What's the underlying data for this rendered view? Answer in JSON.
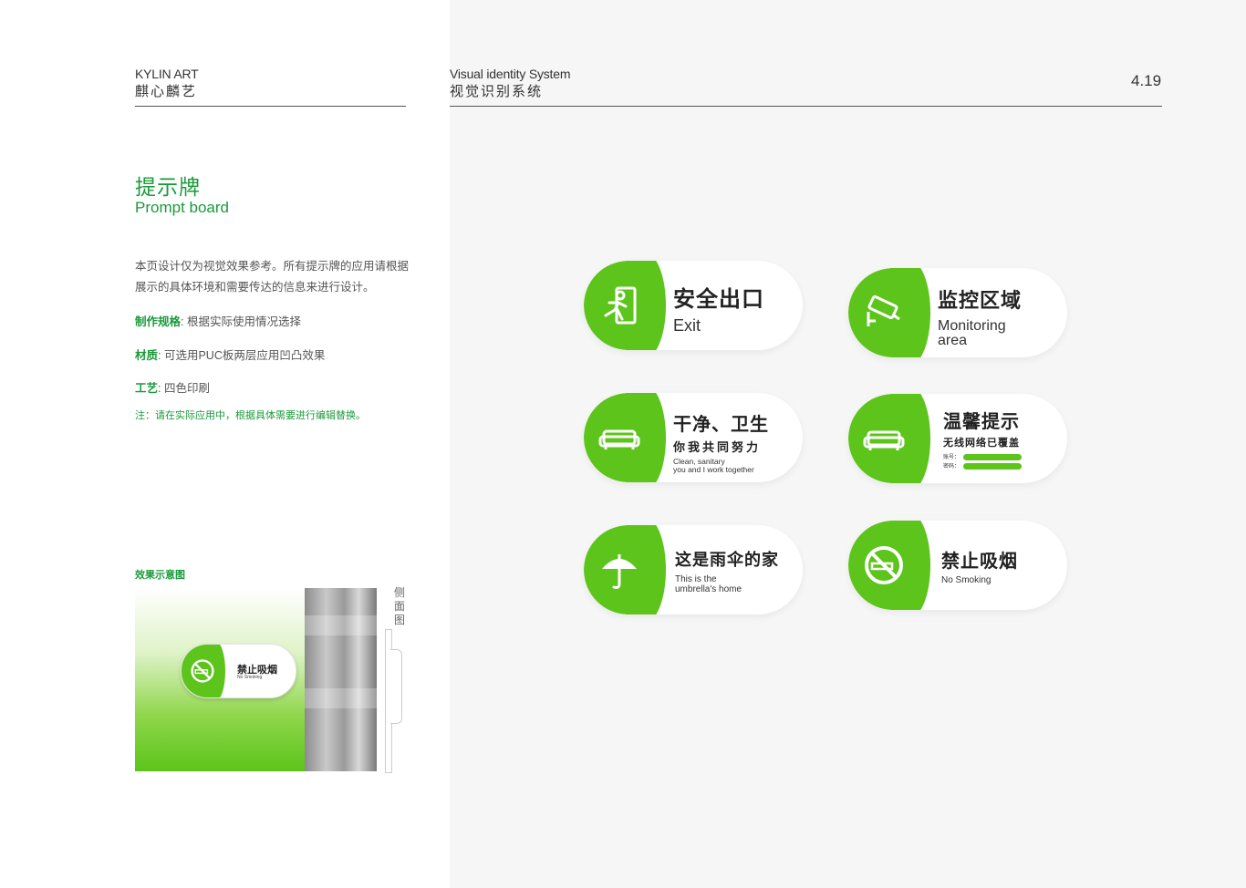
{
  "header": {
    "brand_en": "KYLIN ART",
    "brand_cn": "麒心麟艺",
    "system_en": "Visual identity System",
    "system_cn": "视觉识别系统",
    "page_number": "4.19"
  },
  "section": {
    "title_cn": "提示牌",
    "title_en": "Prompt board",
    "description": "本页设计仅为视觉效果参考。所有提示牌的应用请根据展示的具体环境和需要传达的信息来进行设计。",
    "specs": [
      {
        "label": "制作规格",
        "value": ": 根据实际使用情况选择"
      },
      {
        "label": "材质",
        "value": ": 可选用PUC板两层应用凹凸效果"
      },
      {
        "label": "工艺",
        "value": ": 四色印刷"
      }
    ],
    "note": "注：请在实际应用中，根据具体需要进行编辑替换。"
  },
  "effect": {
    "label": "效果示意图",
    "side_label": "侧面图",
    "mini_sign": {
      "cn": "禁止吸烟",
      "en": "No Smoking"
    }
  },
  "signs": [
    {
      "icon": "exit-runner-icon",
      "cn": "安全出口",
      "en": "Exit"
    },
    {
      "icon": "cctv-camera-icon",
      "cn": "监控区域",
      "en": "Monitoring area"
    },
    {
      "icon": "sofa-icon",
      "cn": "干净、卫生",
      "cn2": "你我共同努力",
      "en": "Clean, sanitary",
      "en2": "you and I work together"
    },
    {
      "icon": "sofa-icon",
      "cn": "温馨提示",
      "cn2": "无线网络已覆盖",
      "field1": "账号：",
      "field2": "密码："
    },
    {
      "icon": "umbrella-icon",
      "cn": "这是雨伞的家",
      "en": "This is the",
      "en2": "umbrella's home"
    },
    {
      "icon": "no-smoking-icon",
      "cn": "禁止吸烟",
      "en": "No Smoking"
    }
  ],
  "colors": {
    "accent_green": "#5cc41a",
    "title_green": "#1a9a3a",
    "panel_gray": "#f6f6f6"
  }
}
